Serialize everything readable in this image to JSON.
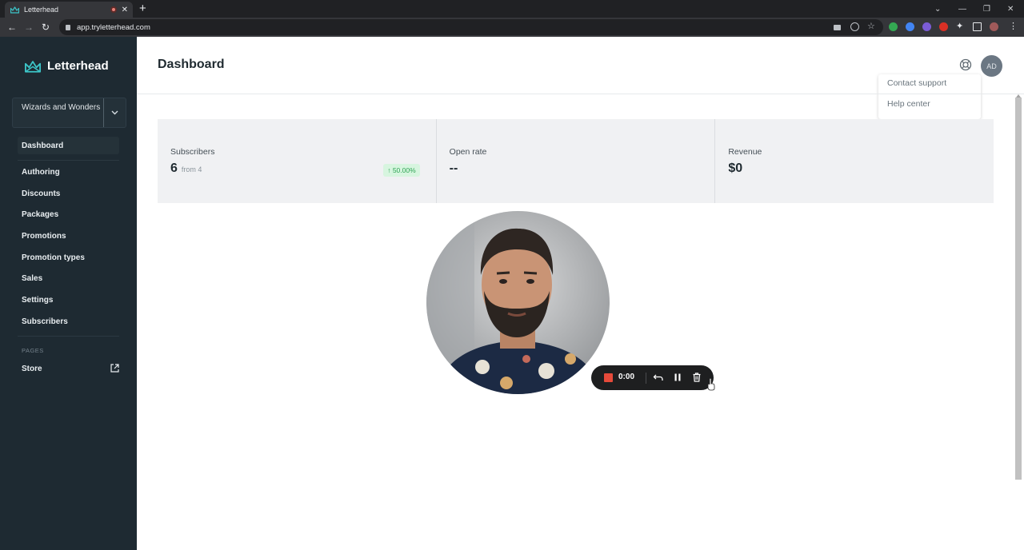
{
  "browser": {
    "tab_title": "Letterhead",
    "url": "app.tryletterhead.com",
    "new_tab_symbol": "+"
  },
  "sidebar": {
    "brand": "Letterhead",
    "org_name": "Wizards and Wonders",
    "items": [
      {
        "label": "Dashboard",
        "active": true
      },
      {
        "label": "Authoring"
      },
      {
        "label": "Discounts"
      },
      {
        "label": "Packages"
      },
      {
        "label": "Promotions"
      },
      {
        "label": "Promotion types"
      },
      {
        "label": "Sales"
      },
      {
        "label": "Settings"
      },
      {
        "label": "Subscribers"
      }
    ],
    "pages_section_label": "PAGES",
    "pages_items": [
      {
        "label": "Store"
      }
    ]
  },
  "header": {
    "title": "Dashboard",
    "avatar_initials": "AD",
    "help_menu": [
      "Contact support",
      "Help center"
    ]
  },
  "stats": [
    {
      "label": "Subscribers",
      "value": "6",
      "sub": "from 4",
      "badge": "50.00%"
    },
    {
      "label": "Open rate",
      "value": "--"
    },
    {
      "label": "Revenue",
      "value": "$0"
    }
  ],
  "recorder": {
    "time": "0:00"
  },
  "colors": {
    "sidebar_bg": "#1e2a32",
    "brand_accent": "#3cc6c9",
    "badge_green": "#2fa454",
    "record_red": "#e64a3a"
  }
}
